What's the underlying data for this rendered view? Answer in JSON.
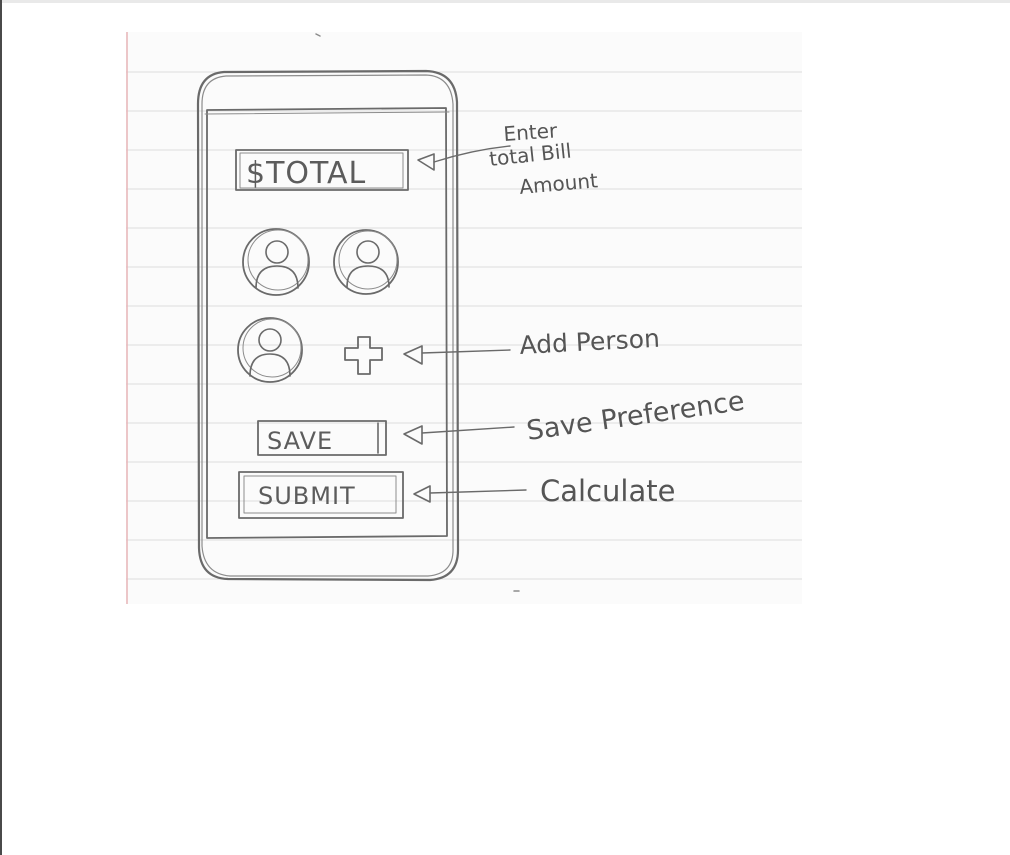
{
  "sketch": {
    "phone": {
      "total_field": "$TOTAL",
      "save_button": "SAVE",
      "submit_button": "SUBMIT",
      "add_person_symbol": "+",
      "person_avatars": [
        "person-icon",
        "person-icon",
        "person-icon"
      ]
    },
    "annotations": {
      "total": [
        "Enter",
        "total Bill",
        "Amount"
      ],
      "add_person": "Add Person",
      "save": "Save Preference",
      "submit": "Calculate"
    },
    "colors": {
      "paper": "#ffffff",
      "ruled_line": "#e4e4e4",
      "margin_line": "#e8b4b8",
      "pencil": "#6a6a6a"
    }
  }
}
